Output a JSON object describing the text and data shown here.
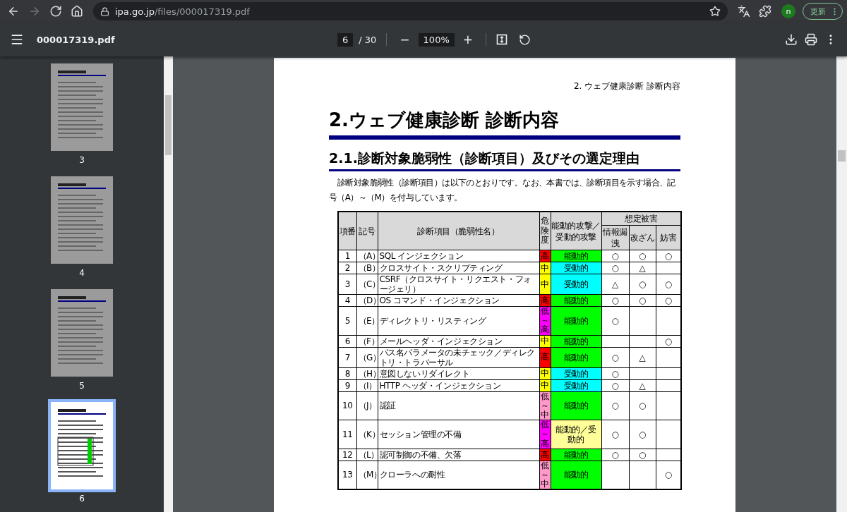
{
  "browser": {
    "back_disabled": false,
    "forward_disabled": true,
    "url_host": "ipa.go.jp",
    "url_path": "/files/000017319.pdf",
    "avatar": "n",
    "update_label": "更新"
  },
  "toolbar": {
    "file_name": "000017319.pdf",
    "page": "6",
    "page_total": "/ 30",
    "zoom_out": "−",
    "zoom": "100%",
    "zoom_in": "+"
  },
  "thumbnails": [
    {
      "label": "3",
      "selected": false
    },
    {
      "label": "4",
      "selected": false
    },
    {
      "label": "5",
      "selected": false
    },
    {
      "label": "6",
      "selected": true
    }
  ],
  "page": {
    "running_header": "2. ウェブ健康診断  診断内容",
    "title": "2.ウェブ健康診断  診断内容",
    "subtitle": "2.1.診断対象脆弱性（診断項目）及びその選定理由",
    "paragraph": "診断対象脆弱性（診断項目）は以下のとおりです。なお、本書では、診断項目を示す場合、記号（A）～（M）を付与しています。",
    "table": {
      "columns": [
        "項番",
        "記号",
        "診断項目（脆弱性名）",
        "危険度",
        "能動的攻撃／受動的攻撃",
        "想定被害"
      ],
      "damage_columns": [
        "情報漏洩",
        "改ざん",
        "妨害"
      ],
      "rows": [
        {
          "no": "1",
          "code": "（A）",
          "name": "SQL インジェクション",
          "risk": {
            "label": "高",
            "color": "#ff0000"
          },
          "attack": {
            "label": "能動的",
            "color": "#00ff00"
          },
          "leak": "○",
          "tamper": "○",
          "disrupt": "○"
        },
        {
          "no": "2",
          "code": "（B）",
          "name": "クロスサイト・スクリプティング",
          "risk": {
            "label": "中",
            "color": "#ffff00"
          },
          "attack": {
            "label": "受動的",
            "color": "#00ffff"
          },
          "leak": "○",
          "tamper": "△",
          "disrupt": ""
        },
        {
          "no": "3",
          "code": "（C）",
          "name": "CSRF（クロスサイト・リクエスト・フォージェリ）",
          "risk": {
            "label": "中",
            "color": "#ffff00"
          },
          "attack": {
            "label": "受動的",
            "color": "#00ffff"
          },
          "leak": "△",
          "tamper": "○",
          "disrupt": "○"
        },
        {
          "no": "4",
          "code": "（D）",
          "name": "OS コマンド・インジェクション",
          "risk": {
            "label": "高",
            "color": "#ff0000"
          },
          "attack": {
            "label": "能動的",
            "color": "#00ff00"
          },
          "leak": "○",
          "tamper": "○",
          "disrupt": "○"
        },
        {
          "no": "5",
          "code": "（E）",
          "name": "ディレクトリ・リスティング",
          "risk": {
            "label": "低～高",
            "color": "#ff00ff"
          },
          "attack": {
            "label": "能動的",
            "color": "#00ff00"
          },
          "leak": "○",
          "tamper": "",
          "disrupt": ""
        },
        {
          "no": "6",
          "code": "（F）",
          "name": "メールヘッダ・インジェクション",
          "risk": {
            "label": "中",
            "color": "#ffff00"
          },
          "attack": {
            "label": "能動的",
            "color": "#00ff00"
          },
          "leak": "",
          "tamper": "",
          "disrupt": "○"
        },
        {
          "no": "7",
          "code": "（G）",
          "name": "パス名パラメータの未チェック／ディレクトリ・トラバーサル",
          "risk": {
            "label": "高",
            "color": "#ff0000"
          },
          "attack": {
            "label": "能動的",
            "color": "#00ff00"
          },
          "leak": "○",
          "tamper": "△",
          "disrupt": ""
        },
        {
          "no": "8",
          "code": "（H）",
          "name": "意図しないリダイレクト",
          "risk": {
            "label": "中",
            "color": "#ffff00"
          },
          "attack": {
            "label": "受動的",
            "color": "#00ffff"
          },
          "leak": "○",
          "tamper": "",
          "disrupt": ""
        },
        {
          "no": "9",
          "code": "（I）",
          "name": "HTTP ヘッダ・インジェクション",
          "risk": {
            "label": "中",
            "color": "#ffff00"
          },
          "attack": {
            "label": "受動的",
            "color": "#00ffff"
          },
          "leak": "○",
          "tamper": "△",
          "disrupt": ""
        },
        {
          "no": "10",
          "code": "（J）",
          "name": "認証",
          "risk": {
            "label": "低～中",
            "color": "#ff99cc"
          },
          "attack": {
            "label": "能動的",
            "color": "#00ff00"
          },
          "leak": "○",
          "tamper": "○",
          "disrupt": ""
        },
        {
          "no": "11",
          "code": "（K）",
          "name": "セッション管理の不備",
          "risk": {
            "label": "低～高",
            "color": "#ff00ff"
          },
          "attack": {
            "label": "能動的／受動的",
            "color": "#ffff99"
          },
          "leak": "○",
          "tamper": "○",
          "disrupt": ""
        },
        {
          "no": "12",
          "code": "（L）",
          "name": "認可制御の不備、欠落",
          "risk": {
            "label": "高",
            "color": "#ff0000"
          },
          "attack": {
            "label": "能動的",
            "color": "#00ff00"
          },
          "leak": "○",
          "tamper": "○",
          "disrupt": ""
        },
        {
          "no": "13",
          "code": "（M）",
          "name": "クローラへの耐性",
          "risk": {
            "label": "低～中",
            "color": "#ff99cc"
          },
          "attack": {
            "label": "能動的",
            "color": "#00ff00"
          },
          "leak": "",
          "tamper": "",
          "disrupt": "○"
        }
      ]
    }
  }
}
